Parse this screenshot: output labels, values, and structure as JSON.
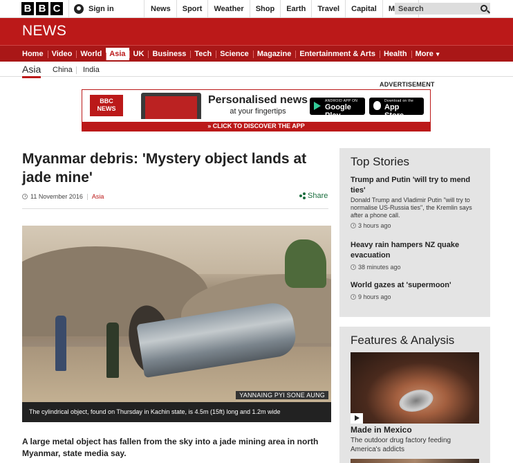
{
  "topbar": {
    "logo_letters": [
      "B",
      "B",
      "C"
    ],
    "signin_label": "Sign in",
    "nav": [
      "News",
      "Sport",
      "Weather",
      "Shop",
      "Earth",
      "Travel",
      "Capital",
      "More"
    ],
    "search_placeholder": "Search"
  },
  "brand": "NEWS",
  "main_nav": [
    "Home",
    "Video",
    "World",
    "Asia",
    "UK",
    "Business",
    "Tech",
    "Science",
    "Magazine",
    "Entertainment & Arts",
    "Health",
    "More"
  ],
  "main_nav_active": "Asia",
  "sub_nav": {
    "current": "Asia",
    "items": [
      "China",
      "India"
    ]
  },
  "advert": {
    "label": "ADVERTISEMENT",
    "badge_top": "BBC",
    "badge_bottom": "NEWS",
    "headline": "Personalised news",
    "subline": "at your fingertips",
    "google_small": "ANDROID APP ON",
    "google_label": "Google Play",
    "apple_small": "Download on the",
    "apple_label": "App Store",
    "cta": "» CLICK TO DISCOVER THE APP"
  },
  "article": {
    "headline": "Myanmar debris: 'Mystery object lands at jade mine'",
    "date": "11 November 2016",
    "section": "Asia",
    "share_label": "Share",
    "image_credit": "YANNAING PYI SONE AUNG",
    "caption": "The cylindrical object, found on Thursday in Kachin state, is 4.5m (15ft) long and 1.2m wide",
    "lede": "A large metal object has fallen from the sky into a jade mining area in north Myanmar, state media say."
  },
  "top_stories": {
    "heading": "Top Stories",
    "items": [
      {
        "title": "Trump and Putin 'will try to mend ties'",
        "summary": "Donald Trump and Vladimir Putin \"will try to normalise US-Russia ties\", the Kremlin says after a phone call.",
        "time": "3 hours ago"
      },
      {
        "title": "Heavy rain hampers NZ quake evacuation",
        "summary": "",
        "time": "38 minutes ago"
      },
      {
        "title": "World gazes at 'supermoon'",
        "summary": "",
        "time": "9 hours ago"
      }
    ]
  },
  "features": {
    "heading": "Features & Analysis",
    "item_title": "Made in Mexico",
    "item_summary": "The outdoor drug factory feeding America's addicts"
  },
  "colors": {
    "bbc_red": "#bb1919",
    "nav_red": "#a91717",
    "share_green": "#1a6e3e",
    "panel_grey": "#e4e4e4"
  }
}
